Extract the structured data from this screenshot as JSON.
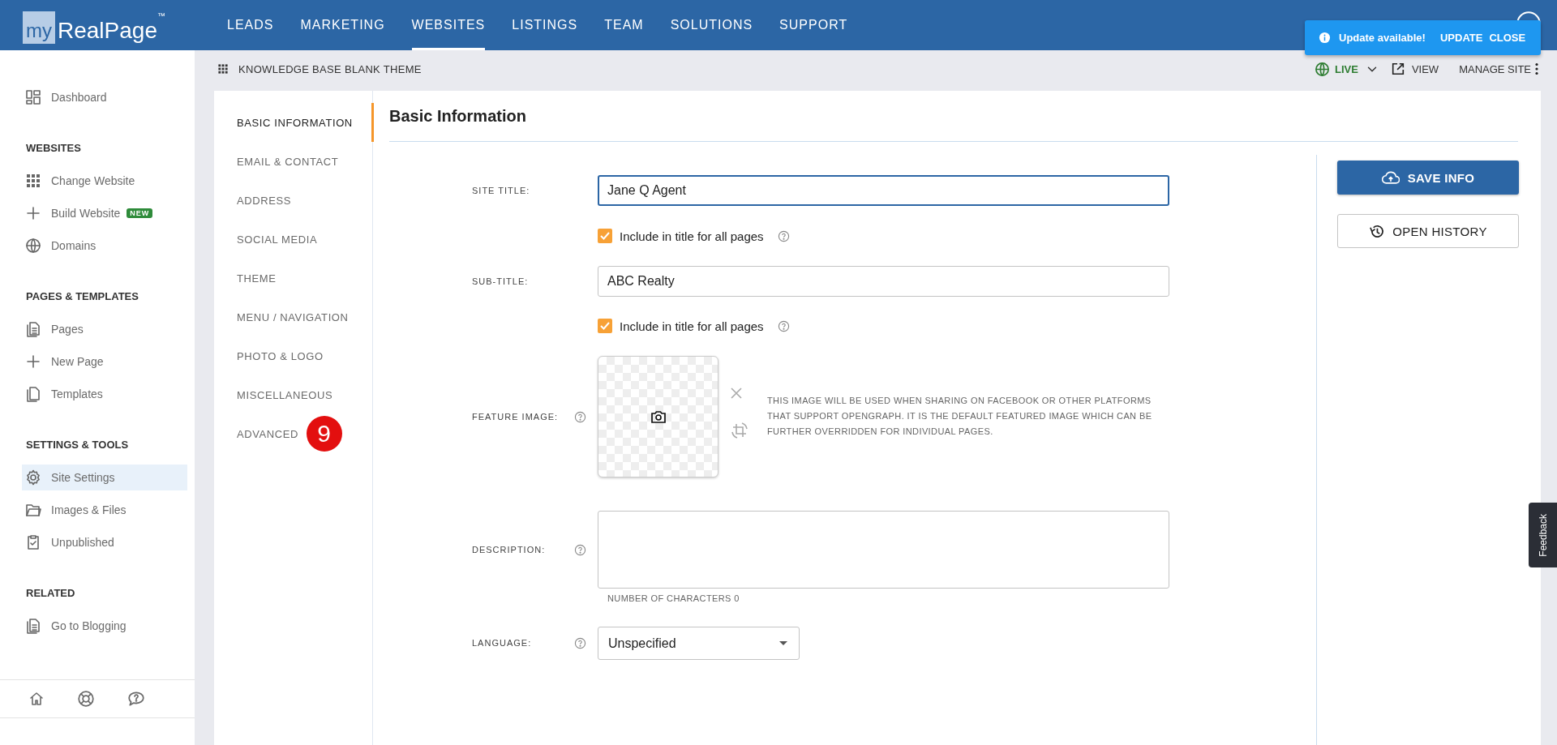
{
  "logo": {
    "prefix": "my",
    "name": "RealPage",
    "mark": "™"
  },
  "nav": [
    {
      "label": "LEADS",
      "selected": false
    },
    {
      "label": "MARKETING",
      "selected": false
    },
    {
      "label": "WEBSITES",
      "selected": true
    },
    {
      "label": "LISTINGS",
      "selected": false
    },
    {
      "label": "TEAM",
      "selected": false
    },
    {
      "label": "SOLUTIONS",
      "selected": false
    },
    {
      "label": "SUPPORT",
      "selected": false
    }
  ],
  "toast": {
    "message": "Update available!",
    "actions": [
      "UPDATE",
      "CLOSE"
    ]
  },
  "site_bar": {
    "title": "KNOWLEDGE BASE BLANK THEME",
    "status": "LIVE",
    "view": "VIEW",
    "manage": "MANAGE SITE"
  },
  "sidebar": {
    "sections": [
      {
        "items": [
          {
            "kind": "dashboard",
            "label": "Dashboard",
            "selected": false
          }
        ]
      },
      {
        "heading": "WEBSITES",
        "items": [
          {
            "kind": "grid",
            "label": "Change Website",
            "selected": false
          },
          {
            "kind": "plus",
            "label": "Build Website",
            "badge": "NEW",
            "selected": false
          },
          {
            "kind": "globe",
            "label": "Domains",
            "selected": false
          }
        ]
      },
      {
        "heading": "PAGES & TEMPLATES",
        "items": [
          {
            "kind": "pages",
            "label": "Pages",
            "selected": false
          },
          {
            "kind": "plus",
            "label": "New Page",
            "selected": false
          },
          {
            "kind": "copy",
            "label": "Templates",
            "selected": false
          }
        ]
      },
      {
        "heading": "SETTINGS & TOOLS",
        "items": [
          {
            "kind": "gear",
            "label": "Site Settings",
            "selected": true
          },
          {
            "kind": "folder",
            "label": "Images & Files",
            "selected": false
          },
          {
            "kind": "clipboard",
            "label": "Unpublished",
            "selected": false
          }
        ]
      },
      {
        "heading": "RELATED",
        "items": [
          {
            "kind": "pages",
            "label": "Go to Blogging",
            "selected": false
          }
        ]
      }
    ]
  },
  "settings_nav": [
    {
      "label": "BASIC INFORMATION",
      "selected": true
    },
    {
      "label": "EMAIL & CONTACT",
      "selected": false
    },
    {
      "label": "ADDRESS",
      "selected": false
    },
    {
      "label": "SOCIAL MEDIA",
      "selected": false
    },
    {
      "label": "THEME",
      "selected": false
    },
    {
      "label": "MENU / NAVIGATION",
      "selected": false
    },
    {
      "label": "PHOTO & LOGO",
      "selected": false
    },
    {
      "label": "MISCELLANEOUS",
      "selected": false
    },
    {
      "label": "ADVANCED",
      "badge": "9",
      "selected": false
    }
  ],
  "form": {
    "title": "Basic Information",
    "fields": [
      {
        "kind": "text",
        "label": "SITE TITLE:",
        "value": "Jane Q Agent",
        "focused": true
      },
      {
        "kind": "checkbox",
        "label": "Include in title for all pages",
        "checked": true,
        "help": true
      },
      {
        "kind": "text",
        "label": "SUB-TITLE:",
        "value": "ABC Realty",
        "focused": false
      },
      {
        "kind": "checkbox",
        "label": "Include in title for all pages",
        "checked": true,
        "help": true
      },
      {
        "kind": "image",
        "label": "FEATURE IMAGE:",
        "help": true,
        "note": "THIS IMAGE WILL BE USED WHEN SHARING ON FACEBOOK OR OTHER PLATFORMS THAT SUPPORT OPENGRAPH. IT IS THE DEFAULT FEATURED IMAGE WHICH CAN BE FURTHER OVERRIDDEN FOR INDIVIDUAL PAGES."
      },
      {
        "kind": "textarea",
        "label": "DESCRIPTION:",
        "help": true,
        "counter": "NUMBER OF CHARACTERS 0"
      },
      {
        "kind": "select",
        "label": "LANGUAGE:",
        "help": true,
        "value": "Unspecified"
      }
    ]
  },
  "actions": [
    {
      "kind": "primary",
      "label": "SAVE INFO"
    },
    {
      "kind": "outline",
      "label": "OPEN HISTORY"
    }
  ],
  "feedback": "Feedback"
}
